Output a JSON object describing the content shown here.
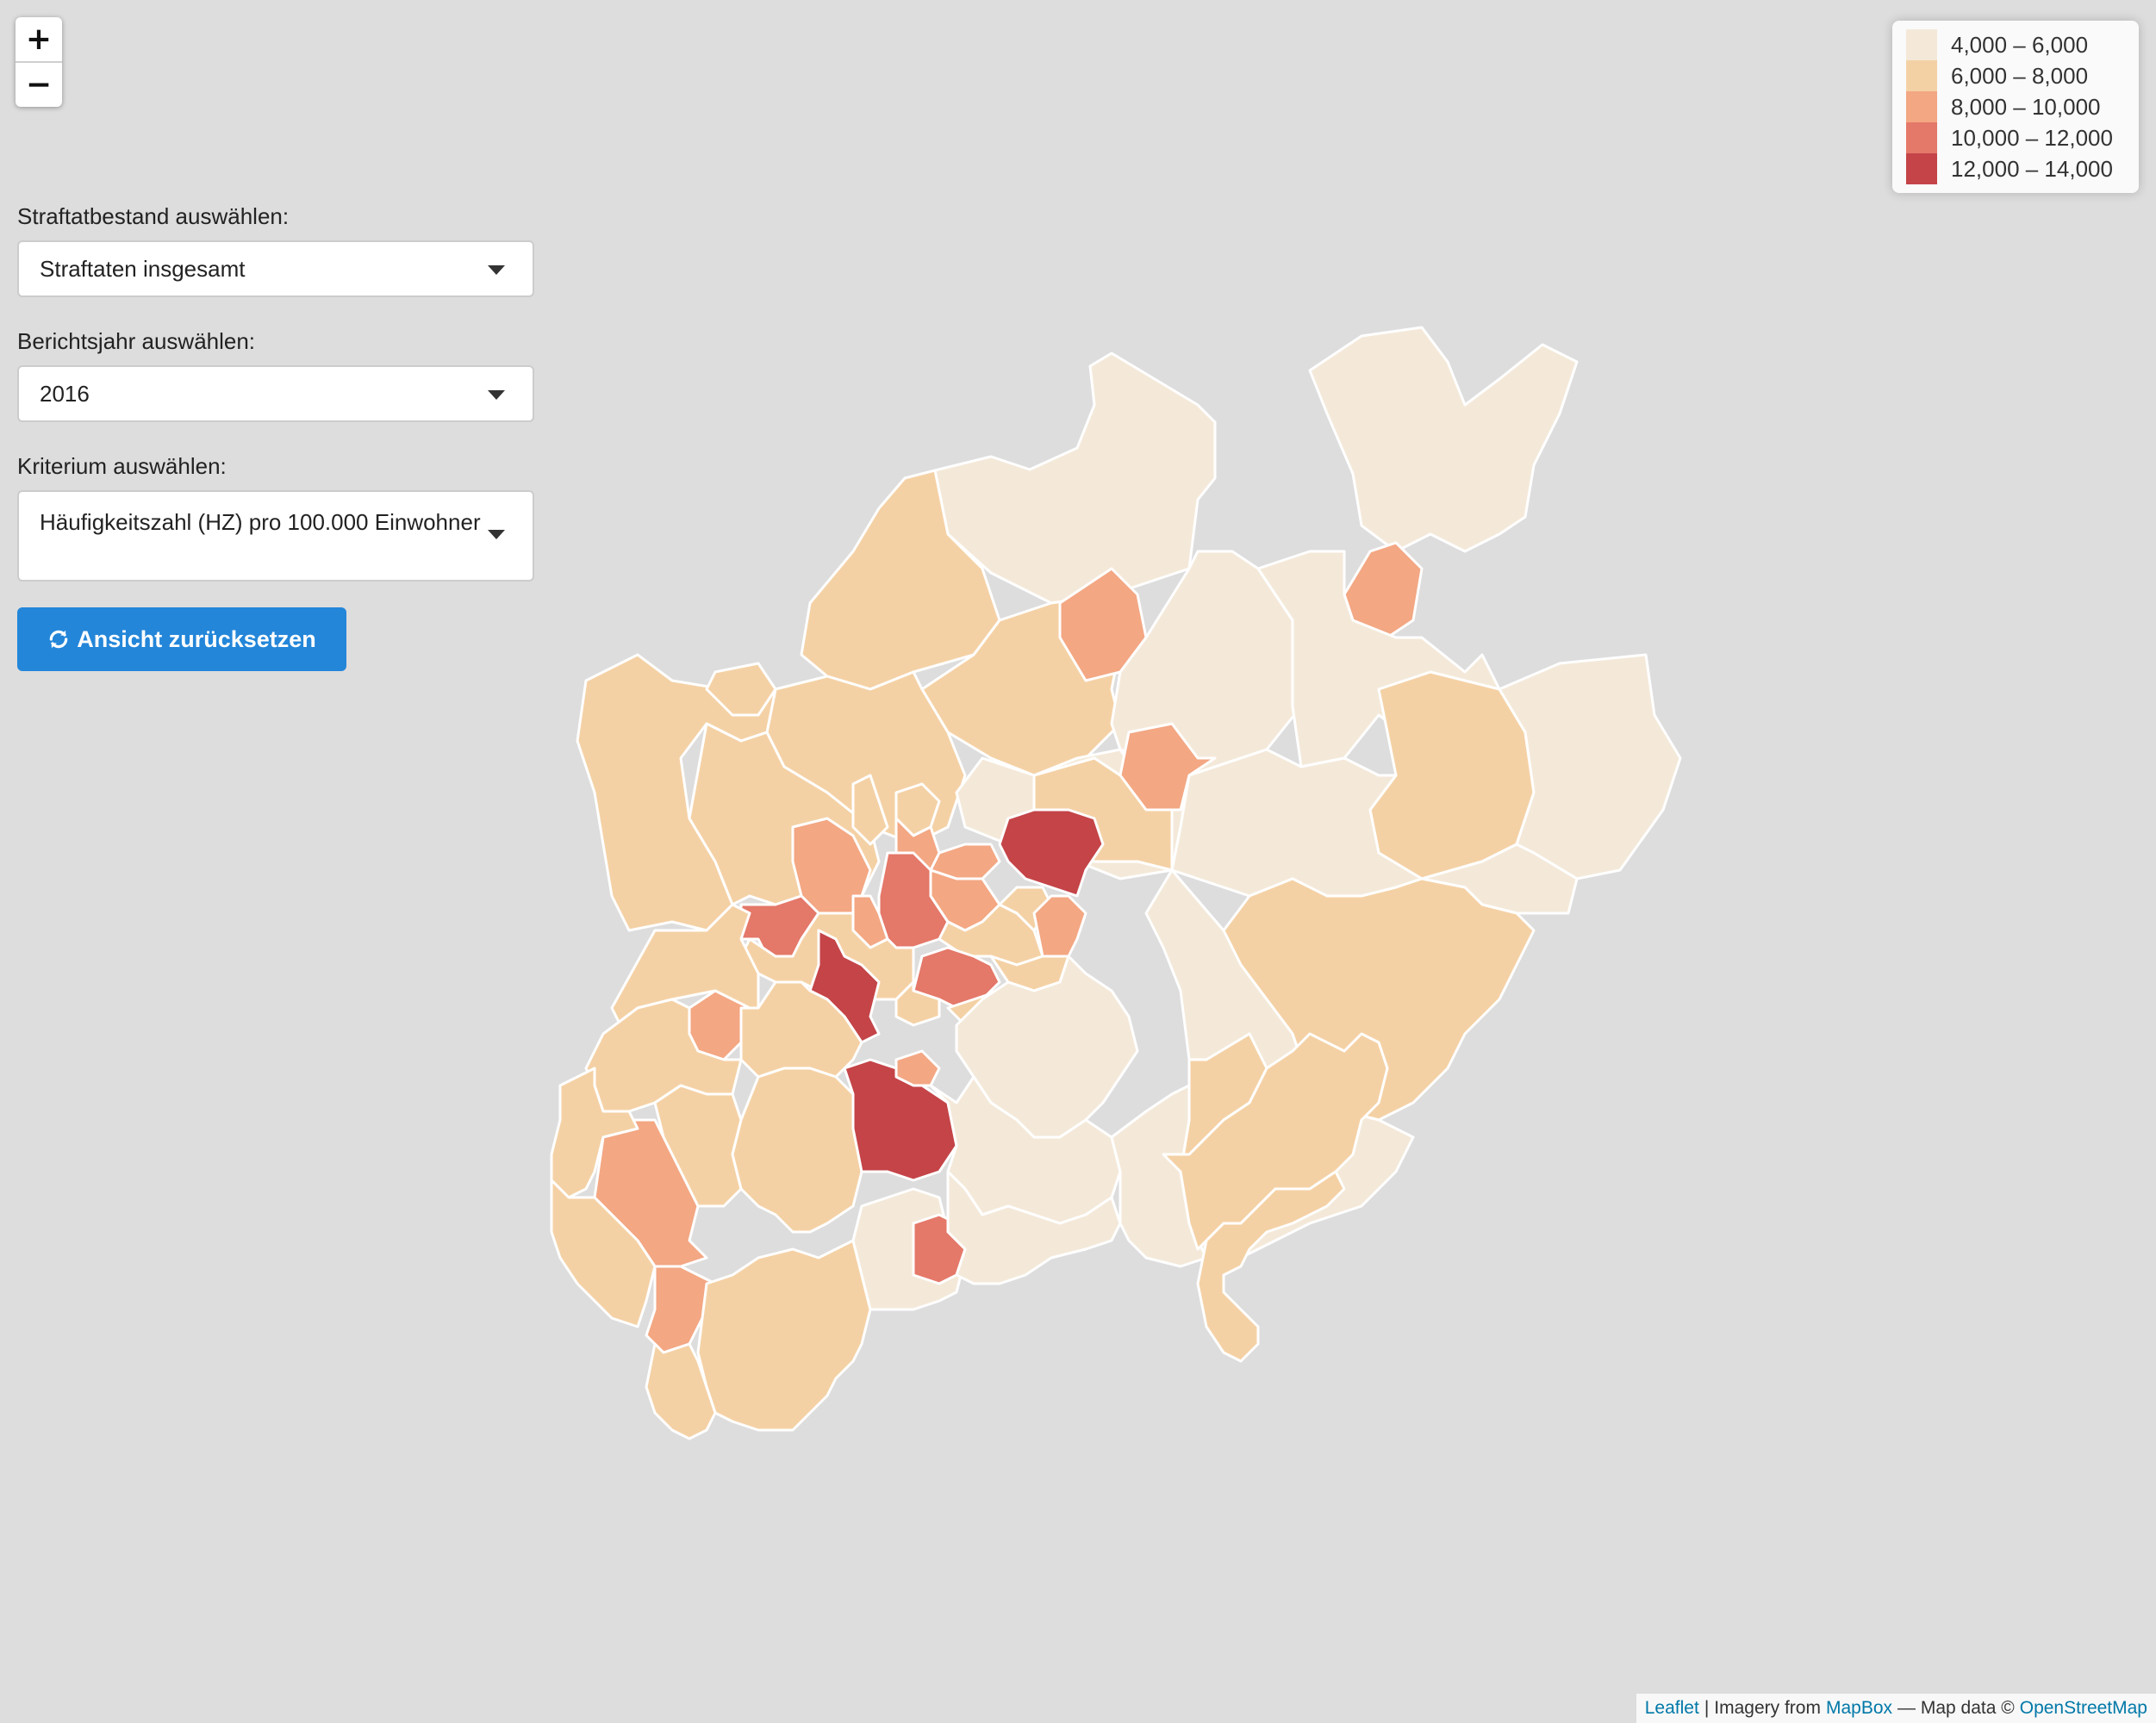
{
  "zoom": {
    "in_label": "+",
    "out_label": "−"
  },
  "controls": {
    "offense": {
      "label": "Straftatbestand auswählen:",
      "value": "Straftaten insgesamt"
    },
    "year": {
      "label": "Berichtsjahr auswählen:",
      "value": "2016"
    },
    "criterion": {
      "label": "Kriterium auswählen:",
      "value": "Häufigkeitszahl (HZ) pro 100.000 Einwohner"
    },
    "reset_label": "Ansicht zurücksetzen"
  },
  "legend": {
    "items": [
      {
        "label": "4,000 – 6,000",
        "color": "#f4e9d9"
      },
      {
        "label": "6,000 – 8,000",
        "color": "#f4d1a5"
      },
      {
        "label": "8,000 – 10,000",
        "color": "#f3a783"
      },
      {
        "label": "10,000 – 12,000",
        "color": "#e47869"
      },
      {
        "label": "12,000 – 14,000",
        "color": "#c44448"
      }
    ]
  },
  "attribution": {
    "leaflet": "Leaflet",
    "sep": "|",
    "imagery": "Imagery from",
    "mapbox": "MapBox",
    "mapdata": "— Map data ©",
    "osm": "OpenStreetMap"
  },
  "colors": {
    "background": "#dddddd",
    "border": "#ffffff",
    "button": "#2386d9"
  }
}
